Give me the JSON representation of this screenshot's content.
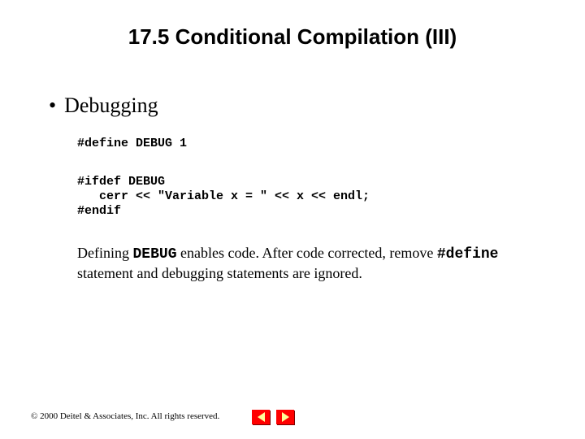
{
  "title": "17.5   Conditional Compilation (III)",
  "bullet": {
    "dot": "•",
    "text": "Debugging"
  },
  "code": {
    "define": "#define DEBUG 1",
    "block": "#ifdef DEBUG\n   cerr << \"Variable x = \" << x << endl;\n#endif"
  },
  "explain": {
    "p1a": "Defining ",
    "p1b": "DEBUG",
    "p1c": " enables code.  After code corrected, remove ",
    "p1d": "#define",
    "p1e": " statement and debugging statements are ignored."
  },
  "footer": {
    "copyright": "© 2000 Deitel & Associates, Inc.  All rights reserved."
  },
  "nav": {
    "prev": "previous-slide",
    "next": "next-slide"
  }
}
